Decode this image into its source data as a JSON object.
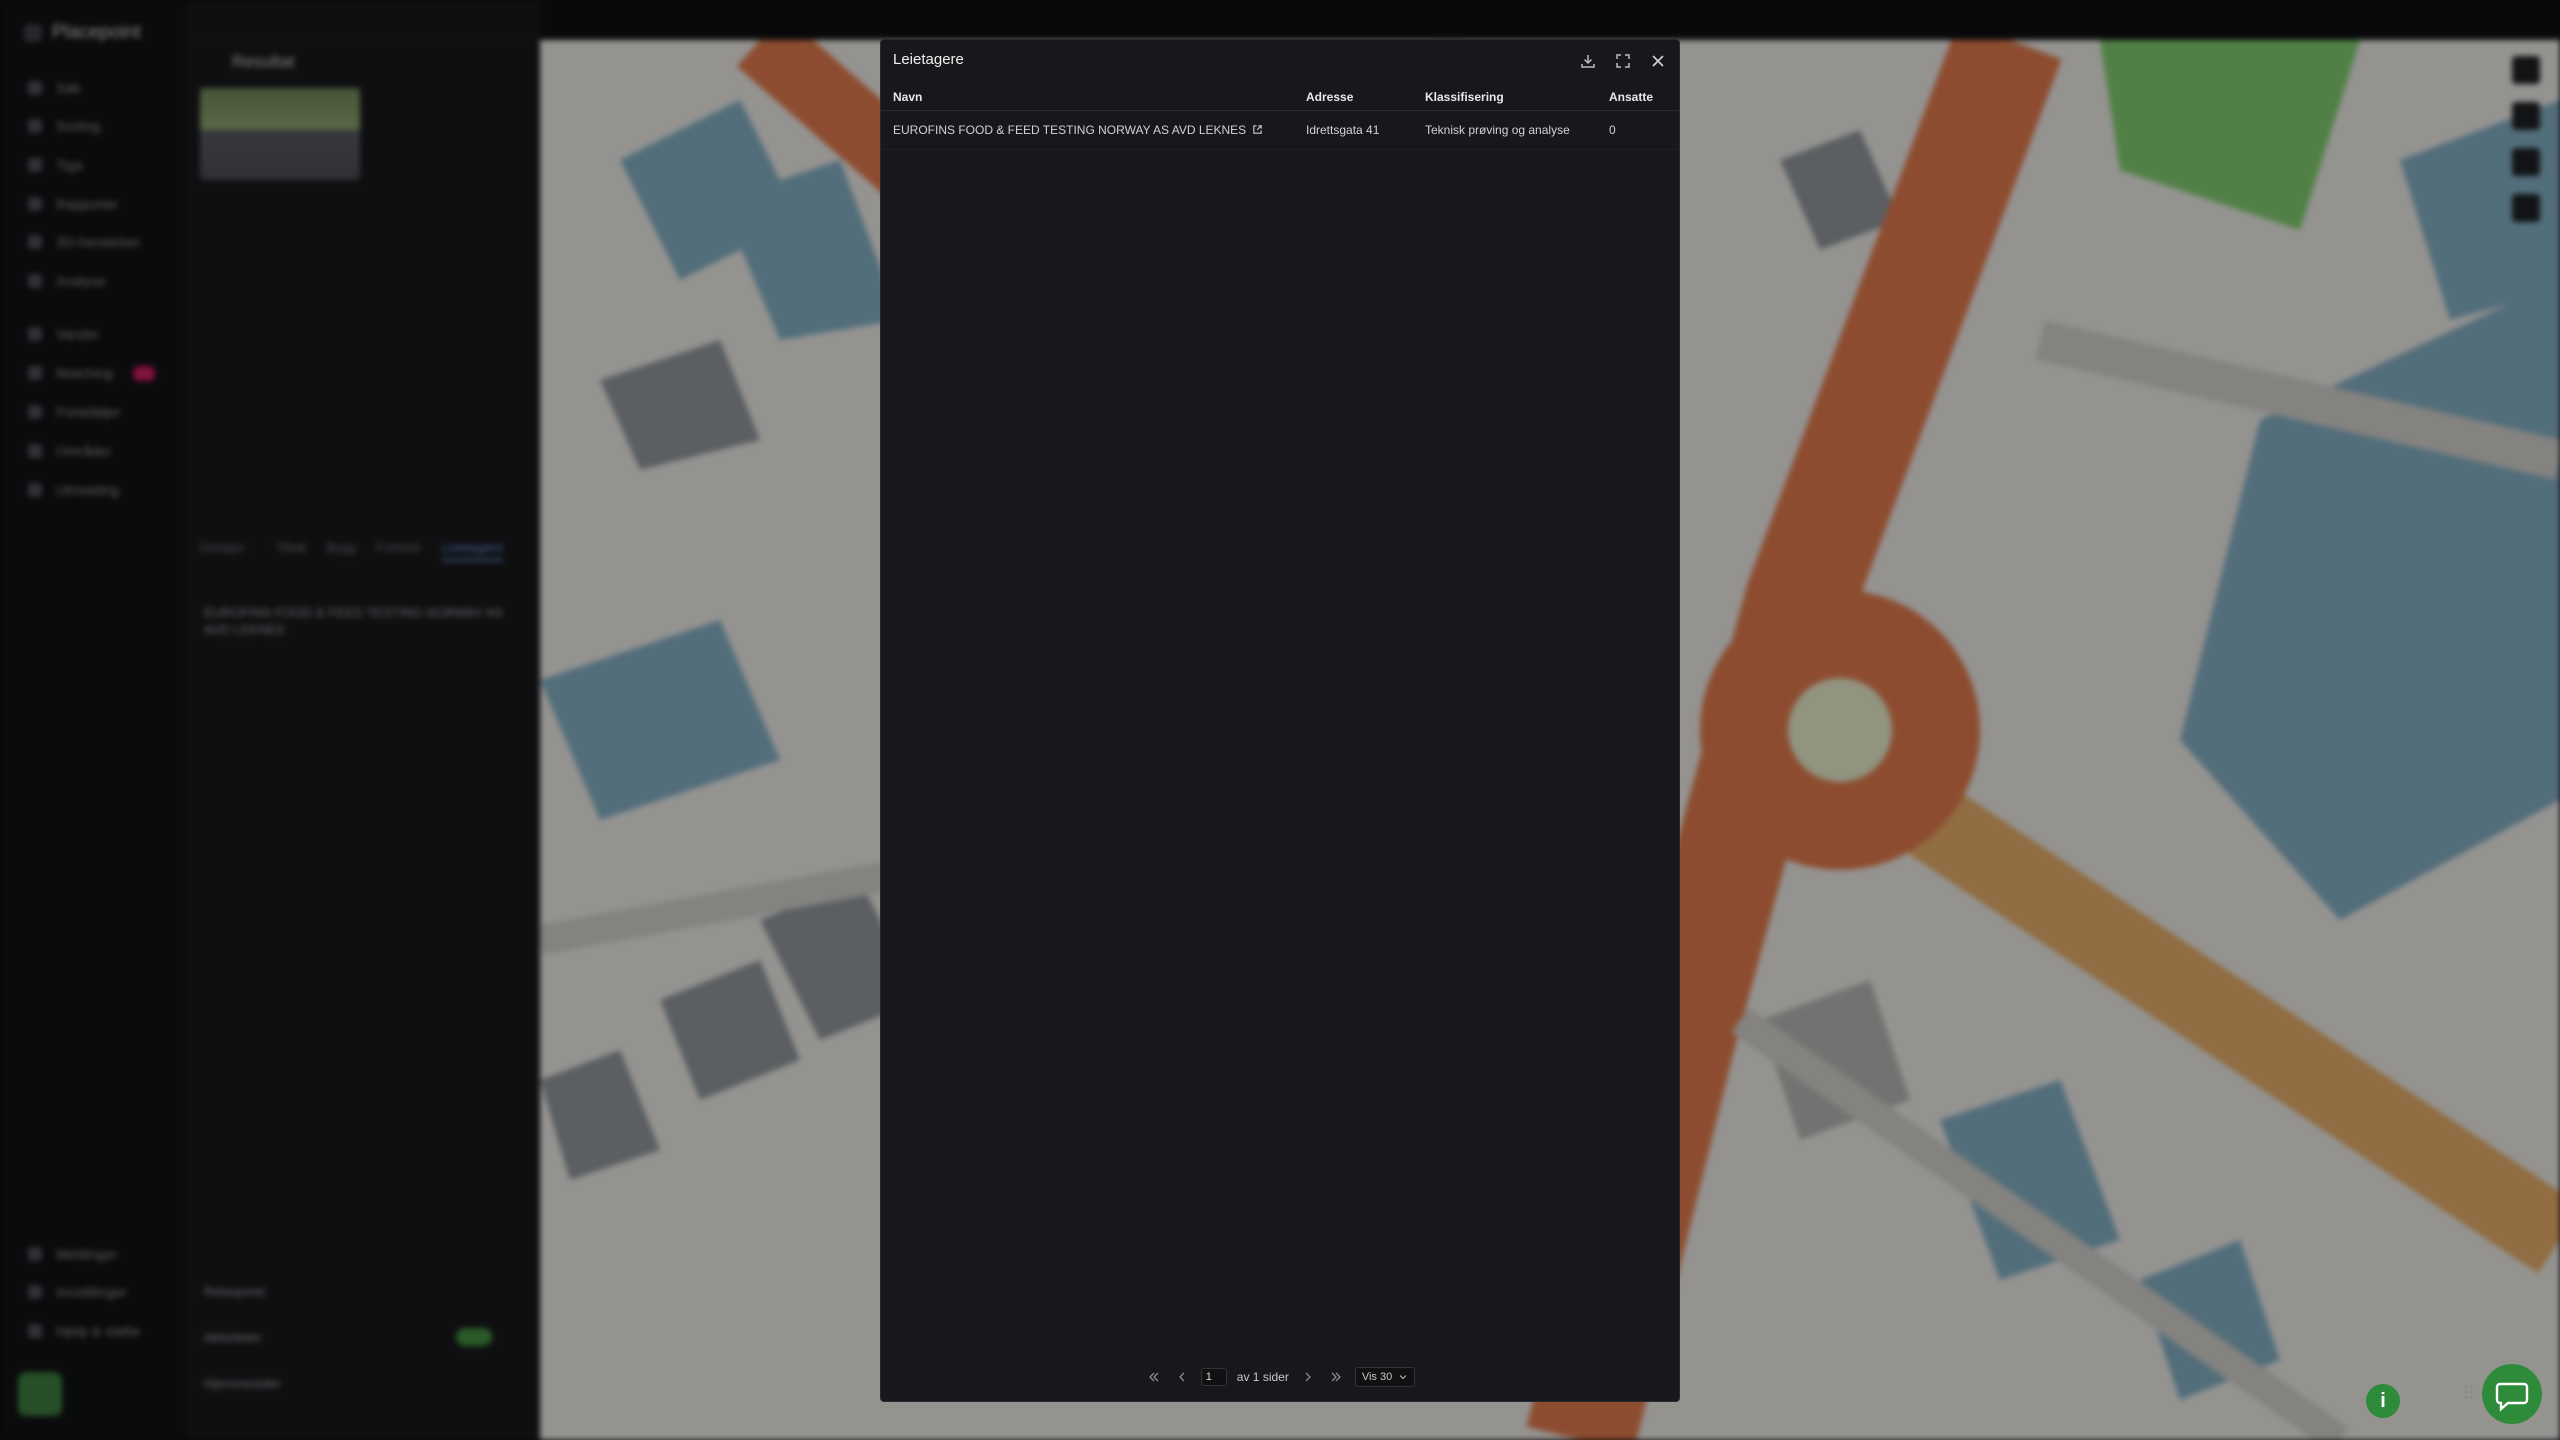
{
  "background": {
    "sidebar": {
      "brand": "Placepoint",
      "items": [
        "Søk",
        "Sorting",
        "Tiga",
        "Rapporter",
        "3D-hendelser",
        "Analyse",
        "Varsler",
        "Matching",
        "Porteføljer",
        "Områder",
        "Utmelding"
      ],
      "bottom_items": [
        "Meldinger",
        "Innstillinger",
        "Hjelp & støtte"
      ]
    },
    "panel": {
      "back_label": "Resultat",
      "tabs": [
        "Detaljer",
        "Tiltak",
        "Bygg",
        "Forhold",
        "Leietagere"
      ],
      "entry": "EUROFINS FOOD & FEED TESTING NORWAY AS AVD LEKNES",
      "bottom_rows": [
        "Relasjoner",
        "Aktiviteter",
        "Hjemmesider"
      ]
    }
  },
  "modal": {
    "title": "Leietagere",
    "actions": {
      "download": "download-icon",
      "expand": "expand-icon",
      "close": "close-icon"
    },
    "columns": {
      "name": "Navn",
      "address": "Adresse",
      "classification": "Klassifisering",
      "employees": "Ansatte"
    },
    "rows": [
      {
        "name": "EUROFINS FOOD & FEED TESTING NORWAY AS AVD LEKNES",
        "address": "Idrettsgata 41",
        "classification": "Teknisk prøving og analyse",
        "employees": "0"
      }
    ],
    "pagination": {
      "current_page": "1",
      "of_pages_text": "av 1 sider",
      "page_size_label": "Vis 30"
    }
  },
  "colors": {
    "accent_green": "#2e8b3a",
    "modal_bg": "#17181b",
    "road_orange": "#d9764a",
    "building_blue": "#7fa9bd"
  }
}
